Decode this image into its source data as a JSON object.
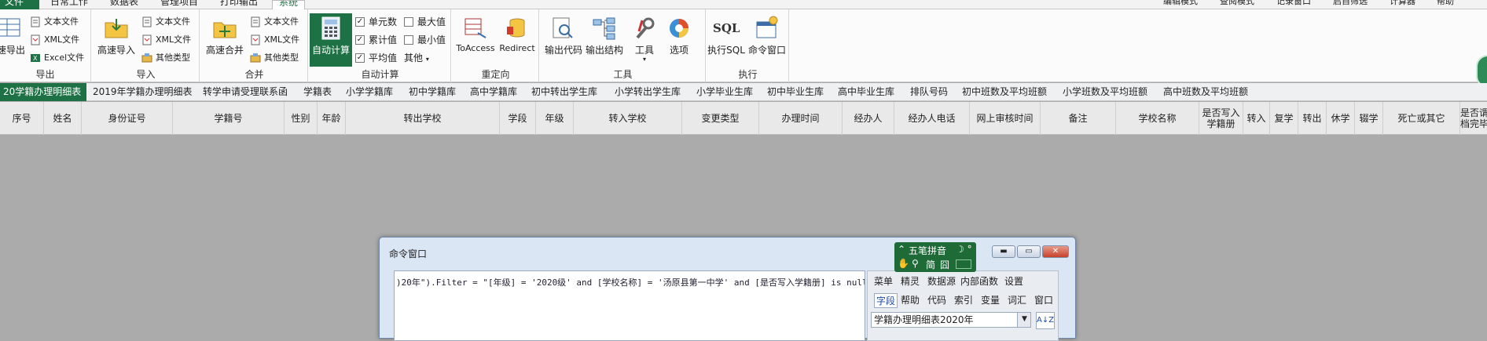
{
  "menu_tabs": [
    {
      "label": "文件"
    },
    {
      "label": "日常工作"
    },
    {
      "label": "数据表"
    },
    {
      "label": "管理项目"
    },
    {
      "label": "打印输出"
    },
    {
      "label": "系统"
    }
  ],
  "quick_access": [
    {
      "label": "编辑模式"
    },
    {
      "label": "查阅模式"
    },
    {
      "label": "记录窗口"
    },
    {
      "label": "启自筛选"
    },
    {
      "label": "计算器"
    },
    {
      "label": "帮助"
    }
  ],
  "ribbon": {
    "export": {
      "label": "导出",
      "big": "速导出",
      "items": [
        "文本文件",
        "XML文件",
        "Excel文件"
      ]
    },
    "import": {
      "label": "导入",
      "big": "高速导入",
      "items": [
        "文本文件",
        "XML文件",
        "其他类型"
      ]
    },
    "merge": {
      "label": "合并",
      "big": "高速合并",
      "items": [
        "文本文件",
        "XML文件",
        "其他类型"
      ]
    },
    "calc": {
      "label": "自动计算",
      "big": "自动计算",
      "checks": [
        {
          "label": "单元数",
          "checked": true
        },
        {
          "label": "最大值",
          "checked": false
        },
        {
          "label": "累计值",
          "checked": true
        },
        {
          "label": "最小值",
          "checked": false
        },
        {
          "label": "平均值",
          "checked": true
        }
      ],
      "other": "其他"
    },
    "redirect": {
      "label": "重定向",
      "items": [
        "ToAccess",
        "Redirect"
      ]
    },
    "tools": {
      "label": "工具",
      "items": [
        "输出代码",
        "输出结构",
        "工具",
        "选项"
      ]
    },
    "exec": {
      "label": "执行",
      "items": [
        "执行SQL",
        "命令窗口"
      ],
      "sql_icon": "SQL"
    }
  },
  "sheet_tabs": [
    {
      "label": "20学籍办理明细表"
    },
    {
      "label": "2019年学籍办理明细表"
    },
    {
      "label": "转学申请受理联系函"
    },
    {
      "label": "学籍表"
    },
    {
      "label": "小学学籍库"
    },
    {
      "label": "初中学籍库"
    },
    {
      "label": "高中学籍库"
    },
    {
      "label": "初中转出学生库"
    },
    {
      "label": "小学转出学生库"
    },
    {
      "label": "小学毕业生库"
    },
    {
      "label": "初中毕业生库"
    },
    {
      "label": "高中毕业生库"
    },
    {
      "label": "排队号码"
    },
    {
      "label": "初中班数及平均班额"
    },
    {
      "label": "小学班数及平均班额"
    },
    {
      "label": "高中班数及平均班额"
    }
  ],
  "columns": [
    {
      "label": "序号"
    },
    {
      "label": "姓名"
    },
    {
      "label": "身份证号"
    },
    {
      "label": "学籍号"
    },
    {
      "label": "性别"
    },
    {
      "label": "年龄"
    },
    {
      "label": "转出学校"
    },
    {
      "label": "学段"
    },
    {
      "label": "年级"
    },
    {
      "label": "转入学校"
    },
    {
      "label": "变更类型"
    },
    {
      "label": "办理时间"
    },
    {
      "label": "经办人"
    },
    {
      "label": "经办人电话"
    },
    {
      "label": "网上审核时间"
    },
    {
      "label": "备注"
    },
    {
      "label": "学校名称"
    },
    {
      "label": "是否写入\n学籍册"
    },
    {
      "label": "转入"
    },
    {
      "label": "复学"
    },
    {
      "label": "转出"
    },
    {
      "label": "休学"
    },
    {
      "label": "辍学"
    },
    {
      "label": "死亡或其它"
    },
    {
      "label": "是否谓\n档完毕"
    }
  ],
  "dialog": {
    "title": "命令窗口",
    "code": ")20年\").Filter = \"[年级] = '2020级' and [学校名称] = '汤原县第一中学' and [是否写入学籍册] is null\"",
    "panel_row1": [
      "菜单",
      "精灵",
      "数据源",
      "内部函数",
      "设置"
    ],
    "panel_row2": [
      "字段",
      "帮助",
      "代码",
      "索引",
      "变量",
      "词汇",
      "窗口"
    ],
    "table_select": "学籍办理明细表2020年",
    "sort_label": "A↓Z"
  },
  "ime": {
    "name": "五笔拼音",
    "mode1": "简",
    "mode2": "囧"
  },
  "colors": {
    "accent": "#1e7145",
    "dialog": "#dbe6f4",
    "background": "#ababab"
  }
}
